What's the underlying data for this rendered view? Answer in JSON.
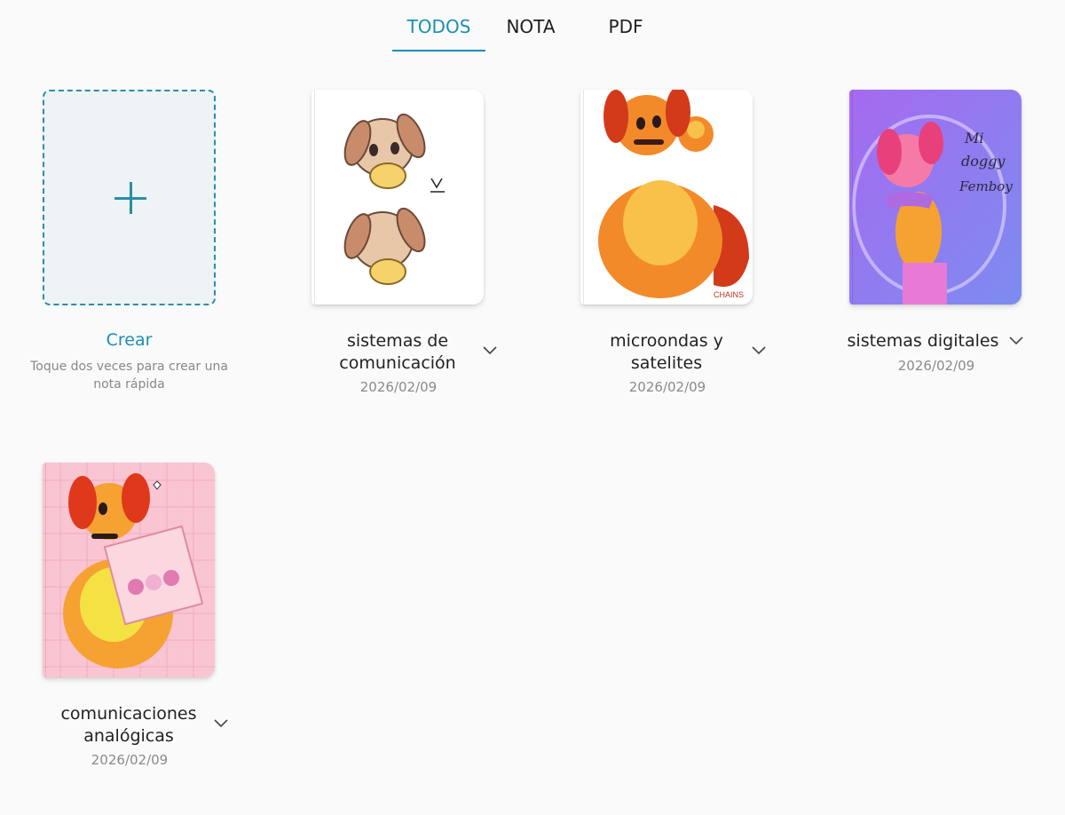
{
  "tabs": [
    {
      "label": "TODOS",
      "active": true
    },
    {
      "label": "NOTA",
      "active": false
    },
    {
      "label": "PDF",
      "active": false
    }
  ],
  "create": {
    "label": "Crear",
    "hint": "Toque dos veces para crear una nota rápida",
    "icon": "plus-icon"
  },
  "notebooks": [
    {
      "title_line1": "sistemas de",
      "title_line2": "comunicación",
      "date": "2026/02/09",
      "cover": "two-puppies-sketch"
    },
    {
      "title_line1": "microondas y",
      "title_line2": "satelites",
      "date": "2026/02/09",
      "cover": "orange-dog-character"
    },
    {
      "title_line1": "sistemas digitales",
      "title_line2": "",
      "date": "2026/02/09",
      "cover": "purple-character-art"
    },
    {
      "title_line1": "comunicaciones",
      "title_line2": "analógicas",
      "date": "2026/02/09",
      "cover": "pink-donut-character"
    }
  ],
  "colors": {
    "accent": "#1a8fb3",
    "create_border": "#2a8ea8",
    "create_fill": "#eef3f6"
  }
}
